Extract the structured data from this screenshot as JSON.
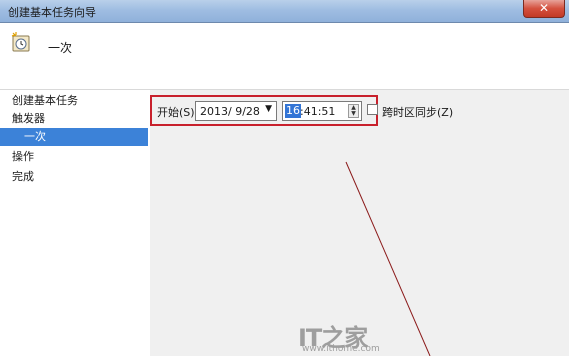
{
  "window": {
    "title": "创建基本任务向导",
    "close_glyph": "✕"
  },
  "header": {
    "heading": "一次",
    "icon": "task-clock-icon"
  },
  "sidebar": {
    "steps": [
      {
        "label": "创建基本任务"
      },
      {
        "label": "触发器"
      },
      {
        "label": "一次"
      },
      {
        "label": "操作"
      },
      {
        "label": "完成"
      }
    ],
    "active_index": 2
  },
  "trigger": {
    "start_label": "开始(S):",
    "date_value": "2013/ 9/28",
    "time_hour": "16",
    "time_rest": ":41:51",
    "sync_label": "跨时区同步(Z)",
    "sync_checked": false
  },
  "watermark": {
    "logo": "IT之家",
    "url": "www.ithome.com"
  },
  "colors": {
    "highlight_box": "#c8202c",
    "selection": "#3c82d8",
    "pointer_line": "#8b1a1a"
  }
}
